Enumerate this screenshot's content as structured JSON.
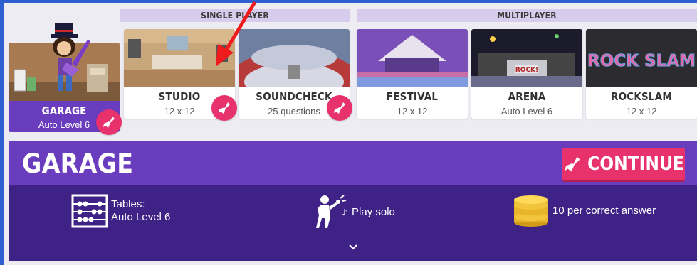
{
  "sections": {
    "single_player": "SINGLE PLAYER",
    "multiplayer": "MULTIPLAYER"
  },
  "modes": {
    "garage": {
      "name": "GARAGE",
      "sub": "Auto Level 6"
    },
    "studio": {
      "name": "STUDIO",
      "sub": "12 x 12"
    },
    "soundcheck": {
      "name": "SOUNDCHECK",
      "sub": "25 questions"
    },
    "festival": {
      "name": "FESTIVAL",
      "sub": "12 x 12"
    },
    "arena": {
      "name": "ARENA",
      "sub": "Auto Level 6",
      "sign": "ROCK!"
    },
    "rockslam": {
      "name": "ROCKSLAM",
      "sub": "12 x 12",
      "logo": "ROCK SLAM"
    }
  },
  "panel": {
    "title": "GARAGE",
    "continue_label": "CONTINUE",
    "tables_label": "Tables:",
    "tables_value": "Auto Level 6",
    "play_label": "Play solo",
    "coins_label": "10 per correct answer"
  },
  "colors": {
    "purple": "#6a3dbf",
    "dark_purple": "#3f2286",
    "pink": "#e8326e",
    "header_lilac": "#d7cceb",
    "outer_blue": "#2d5fd0"
  },
  "icons": [
    "guitar-icon",
    "abacus-icon",
    "singer-icon",
    "coins-icon",
    "chevron-down-icon",
    "red-arrow"
  ]
}
